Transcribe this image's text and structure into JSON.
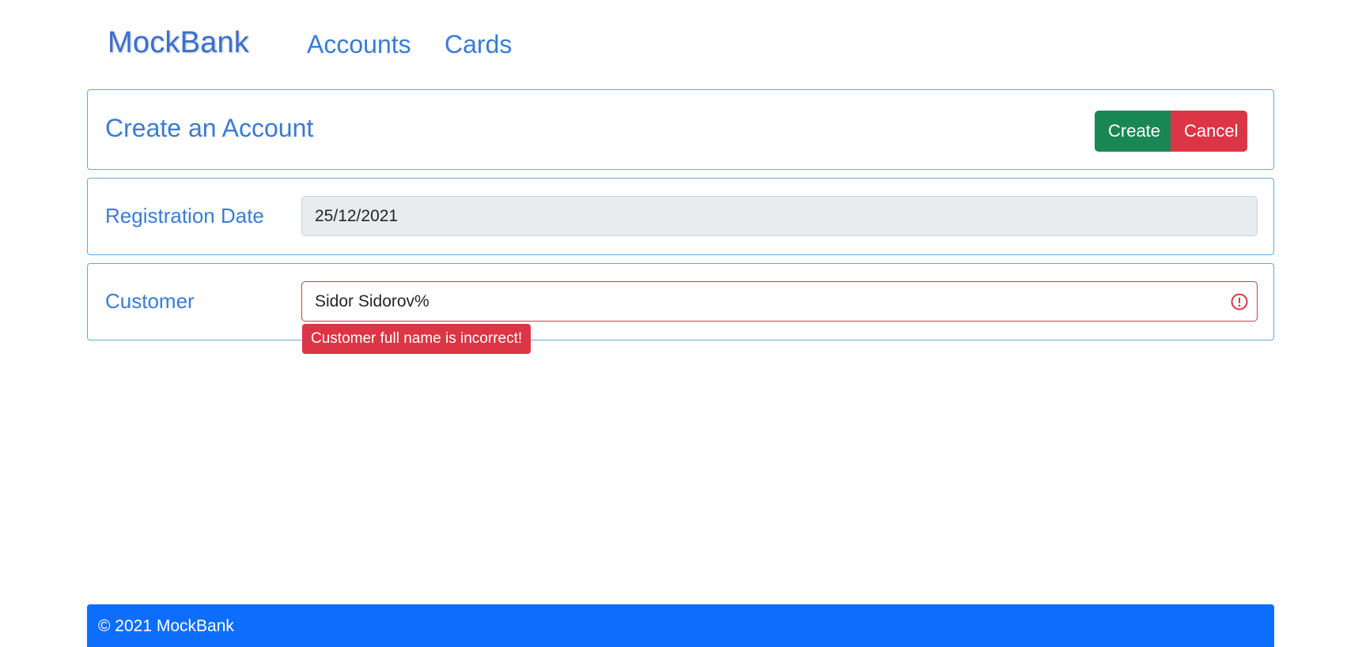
{
  "navbar": {
    "brand": "MockBank",
    "links": [
      {
        "label": "Accounts"
      },
      {
        "label": "Cards"
      }
    ]
  },
  "header": {
    "title": "Create an Account",
    "create_label": "Create",
    "cancel_label": "Cancel"
  },
  "form": {
    "registration_date": {
      "label": "Registration Date",
      "value": "25/12/2021"
    },
    "customer": {
      "label": "Customer",
      "value": "Sidor Sidorov%",
      "error": "Customer full name is incorrect!",
      "icon": "exclamation-circle-icon"
    }
  },
  "footer": {
    "text": "© 2021 MockBank"
  },
  "colors": {
    "accent": "#3a7bd5",
    "success": "#198754",
    "danger": "#dc3545",
    "footer_bg": "#0d6efd",
    "readonly_bg": "#e9ecef"
  }
}
